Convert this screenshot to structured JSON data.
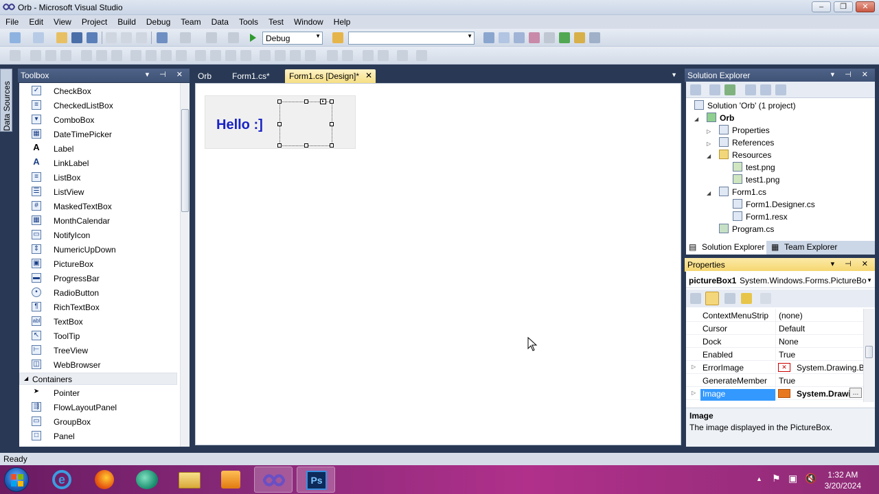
{
  "window": {
    "title": "Orb - Microsoft Visual Studio"
  },
  "menu": [
    "File",
    "Edit",
    "View",
    "Project",
    "Build",
    "Debug",
    "Team",
    "Data",
    "Tools",
    "Test",
    "Window",
    "Help"
  ],
  "toolbar": {
    "config_value": "Debug",
    "platform_value": ""
  },
  "data_sources": "Data Sources",
  "toolbox": {
    "title": "Toolbox",
    "items": [
      "CheckBox",
      "CheckedListBox",
      "ComboBox",
      "DateTimePicker",
      "Label",
      "LinkLabel",
      "ListBox",
      "ListView",
      "MaskedTextBox",
      "MonthCalendar",
      "NotifyIcon",
      "NumericUpDown",
      "PictureBox",
      "ProgressBar",
      "RadioButton",
      "RichTextBox",
      "TextBox",
      "ToolTip",
      "TreeView",
      "WebBrowser"
    ],
    "group": "Containers",
    "group_items": [
      "Pointer",
      "FlowLayoutPanel",
      "GroupBox",
      "Panel"
    ]
  },
  "tabs": [
    "Orb",
    "Form1.cs*",
    "Form1.cs [Design]*"
  ],
  "designer": {
    "label_text": "Hello :]"
  },
  "solution_explorer": {
    "title": "Solution Explorer",
    "solution": "Solution 'Orb' (1 project)",
    "project": "Orb",
    "properties": "Properties",
    "references": "References",
    "resources": "Resources",
    "res1": "test.png",
    "res2": "test1.png",
    "form": "Form1.cs",
    "designer_file": "Form1.Designer.cs",
    "resx": "Form1.resx",
    "program": "Program.cs",
    "tab1": "Solution Explorer",
    "tab2": "Team Explorer"
  },
  "properties": {
    "title": "Properties",
    "object_name": "pictureBox1",
    "object_type": "System.Windows.Forms.PictureBo",
    "rows": [
      {
        "name": "ContextMenuStrip",
        "value": "(none)"
      },
      {
        "name": "Cursor",
        "value": "Default"
      },
      {
        "name": "Dock",
        "value": "None"
      },
      {
        "name": "Enabled",
        "value": "True"
      },
      {
        "name": "ErrorImage",
        "value": "System.Drawing.B"
      },
      {
        "name": "GenerateMember",
        "value": "True"
      },
      {
        "name": "Image",
        "value": "System.Drawi"
      }
    ],
    "desc_title": "Image",
    "desc_text": "The image displayed in the PictureBox."
  },
  "status": "Ready",
  "clock": {
    "time": "1:32 AM",
    "date": "3/20/2024"
  }
}
